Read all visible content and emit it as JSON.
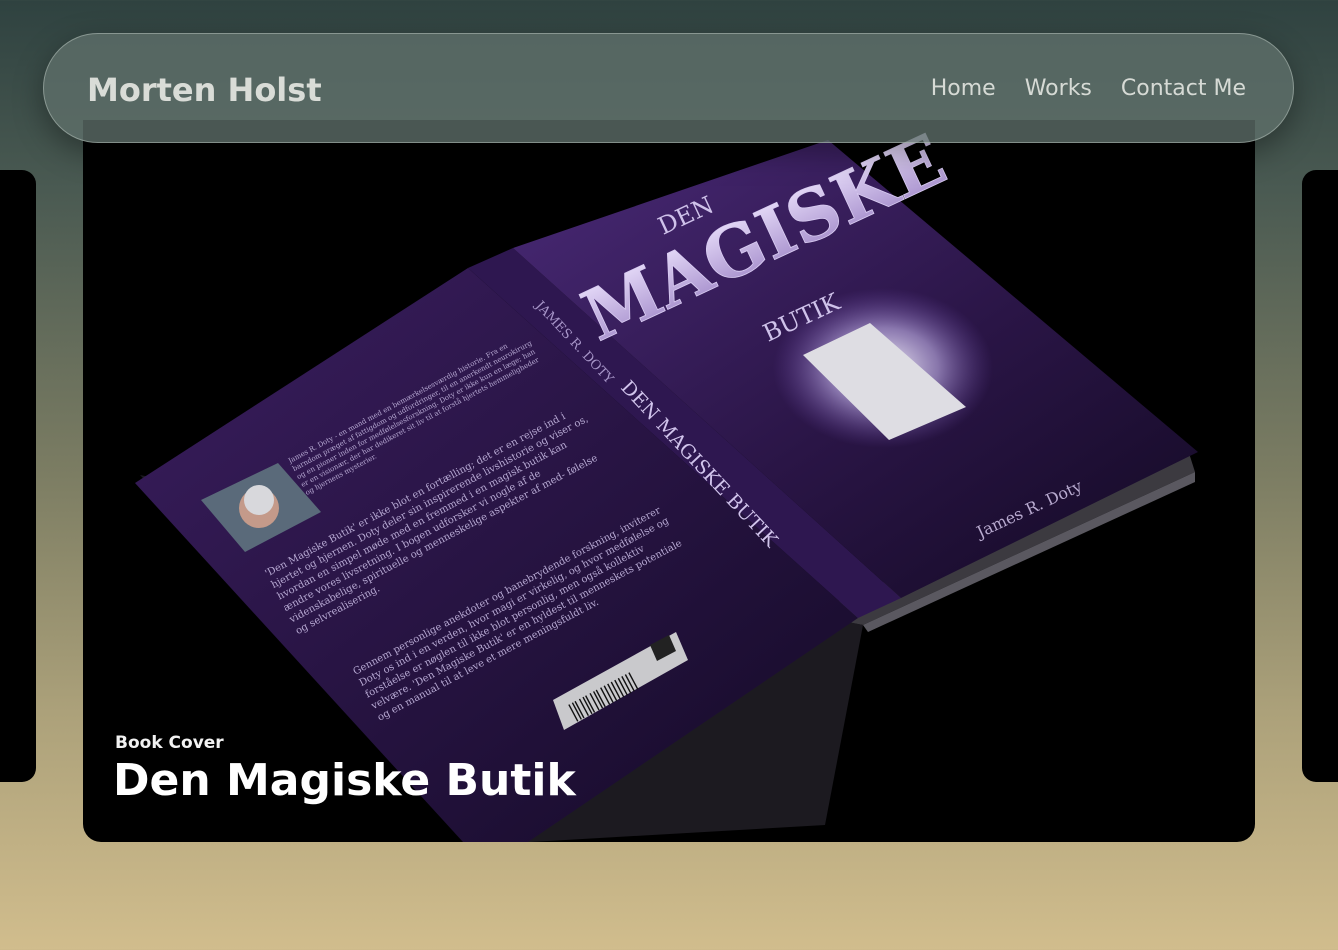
{
  "brand": {
    "name": "Morten Holst"
  },
  "nav": {
    "items": [
      {
        "label": "Home"
      },
      {
        "label": "Works"
      },
      {
        "label": "Contact Me"
      }
    ]
  },
  "hero": {
    "category": "Book Cover",
    "title": "Den Magiske Butik",
    "book": {
      "title_line1": "DEN",
      "title_line2": "MAGISKE",
      "title_line3": "BUTIK",
      "author": "James R. Doty",
      "spine_author": "JAMES R. DOTY",
      "spine_title": "DEN MAGISKE BUTIK",
      "back_paragraph1": "James R. Doty - en mand med en bemærkelsesværdig historie. Fra en barndom præget af fattigdom og udfordringer, til en anerkendt neurokirurg og en pioner inden for medfølelsesforskning. Doty er ikke kun en læge; han er en visionær, der har dedikeret sit liv til at forstå hjertets hemmeligheder og hjernens mysterier.",
      "back_paragraph2": "'Den Magiske Butik' er ikke blot en fortælling; det er en rejse ind i hjertet og hjernen. Doty deler sin inspirerende livshistorie og viser os, hvordan en simpel møde med en fremmed i en magisk butik kan ændre vores livsretning. I bogen udforsker vi nogle af de videnskabelige, spirituelle og menneskelige aspekter af med- følelse og selvrealisering.",
      "back_paragraph3": "Gennem personlige anekdoter og banebrydende forskning, inviterer Doty os ind i en verden, hvor magi er virkelig, og hvor medfølelse og forståelse er nøglen til ikke blot personlig, men også kollektiv velvære. 'Den Magiske Butik' er en hyldest til menneskets potentiale og en manual til at leve et mere meningsfuldt liv."
    }
  },
  "colors": {
    "accent": "#5a2d82",
    "background": "#000000",
    "nav_bg": "#5f706a"
  }
}
